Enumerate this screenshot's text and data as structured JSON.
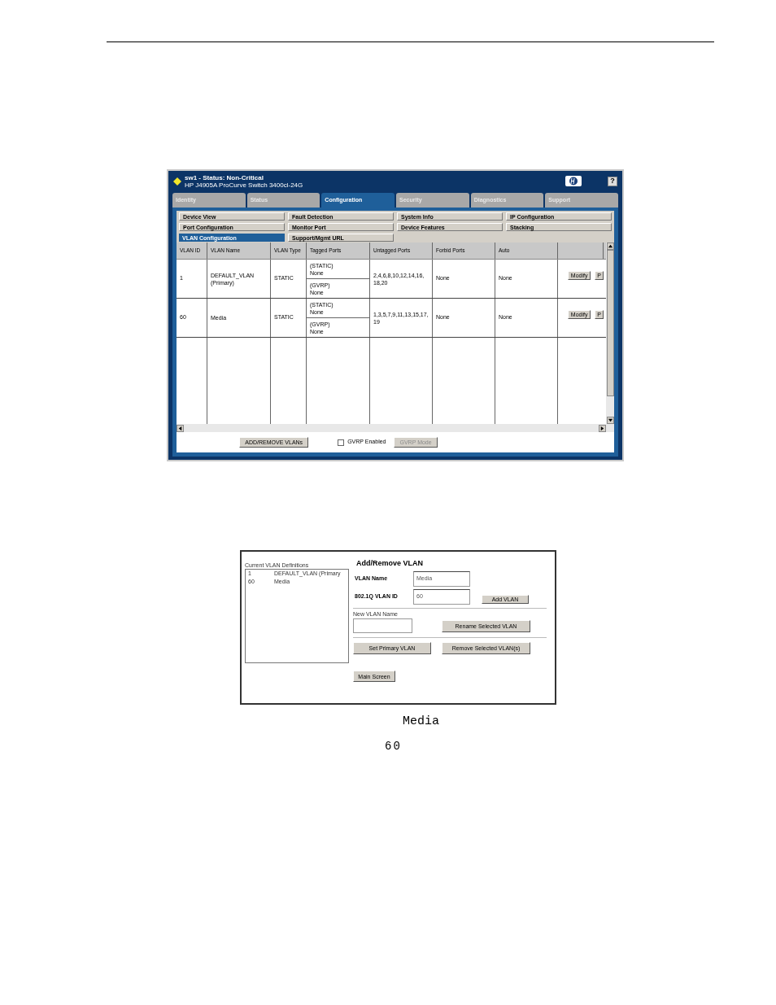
{
  "switch_window": {
    "title": "sw1 - Status: Non-Critical",
    "subtitle": "HP J4905A ProCurve Switch 3400cl-24G",
    "help_button": "?",
    "tabs": [
      {
        "label": "Identity",
        "selected": false
      },
      {
        "label": "Status",
        "selected": false
      },
      {
        "label": "Configuration",
        "selected": true
      },
      {
        "label": "Security",
        "selected": false
      },
      {
        "label": "Diagnostics",
        "selected": false
      },
      {
        "label": "Support",
        "selected": false
      }
    ],
    "menu_buttons": [
      {
        "label": "Device View",
        "selected": false
      },
      {
        "label": "Fault Detection",
        "selected": false
      },
      {
        "label": "System Info",
        "selected": false
      },
      {
        "label": "IP Configuration",
        "selected": false
      },
      {
        "label": "Port Configuration",
        "selected": false
      },
      {
        "label": "Monitor Port",
        "selected": false
      },
      {
        "label": "Device Features",
        "selected": false
      },
      {
        "label": "Stacking",
        "selected": false
      },
      {
        "label": "VLAN Configuration",
        "selected": true
      },
      {
        "label": "Support/Mgmt URL",
        "selected": false
      }
    ],
    "table": {
      "columns": [
        "VLAN ID",
        "VLAN Name",
        "VLAN Type",
        "Tagged Ports",
        "Untagged Ports",
        "Forbid Ports",
        "Auto"
      ],
      "rows": [
        {
          "vlan_id": "1",
          "name": "DEFAULT_VLAN",
          "note": "(Primary)",
          "type": "STATIC",
          "tagged": [
            {
              "label": "(STATIC)",
              "value": "None"
            },
            {
              "label": "(GVRP)",
              "value": "None"
            }
          ],
          "untagged": [
            "2,4,6,8,10,12,14,16,",
            "18,20"
          ],
          "forbid": "None",
          "auto": "None",
          "actions": [
            "Modify",
            "P"
          ]
        },
        {
          "vlan_id": "60",
          "name": "Media",
          "type": "STATIC",
          "tagged": [
            {
              "label": "(STATIC)",
              "value": "None"
            },
            {
              "label": "(GVRP)",
              "value": "None"
            }
          ],
          "untagged": [
            "1,3,5,7,9,11,13,15,17,",
            "19"
          ],
          "forbid": "None",
          "auto": "None",
          "actions": [
            "Modify",
            "P"
          ]
        }
      ]
    },
    "add_remove_button": "ADD/REMOVE VLANs",
    "gvrp_checkbox": {
      "label": "GVRP Enabled",
      "checked": false
    },
    "gvrp_mode_button": {
      "label": "GVRP Mode",
      "disabled": true
    }
  },
  "vlan_dialog": {
    "definitions_label": "Current VLAN Definitions",
    "definitions": [
      {
        "id": "1",
        "name": "DEFAULT_VLAN (Primary"
      },
      {
        "id": "60",
        "name": "Media"
      }
    ],
    "title": "Add/Remove VLAN",
    "fields": [
      {
        "label": "VLAN Name",
        "value": "Media"
      },
      {
        "label": "802.1Q VLAN ID",
        "value": "60"
      }
    ],
    "add_button": "Add VLAN",
    "new_name_label": "New VLAN Name",
    "rename_button": "Rename Selected VLAN",
    "set_primary_button": "Set Primary VLAN",
    "remove_button": "Remove Selected VLAN(s)",
    "main_screen_button": "Main Screen"
  },
  "captions": [
    "Media",
    "60"
  ]
}
